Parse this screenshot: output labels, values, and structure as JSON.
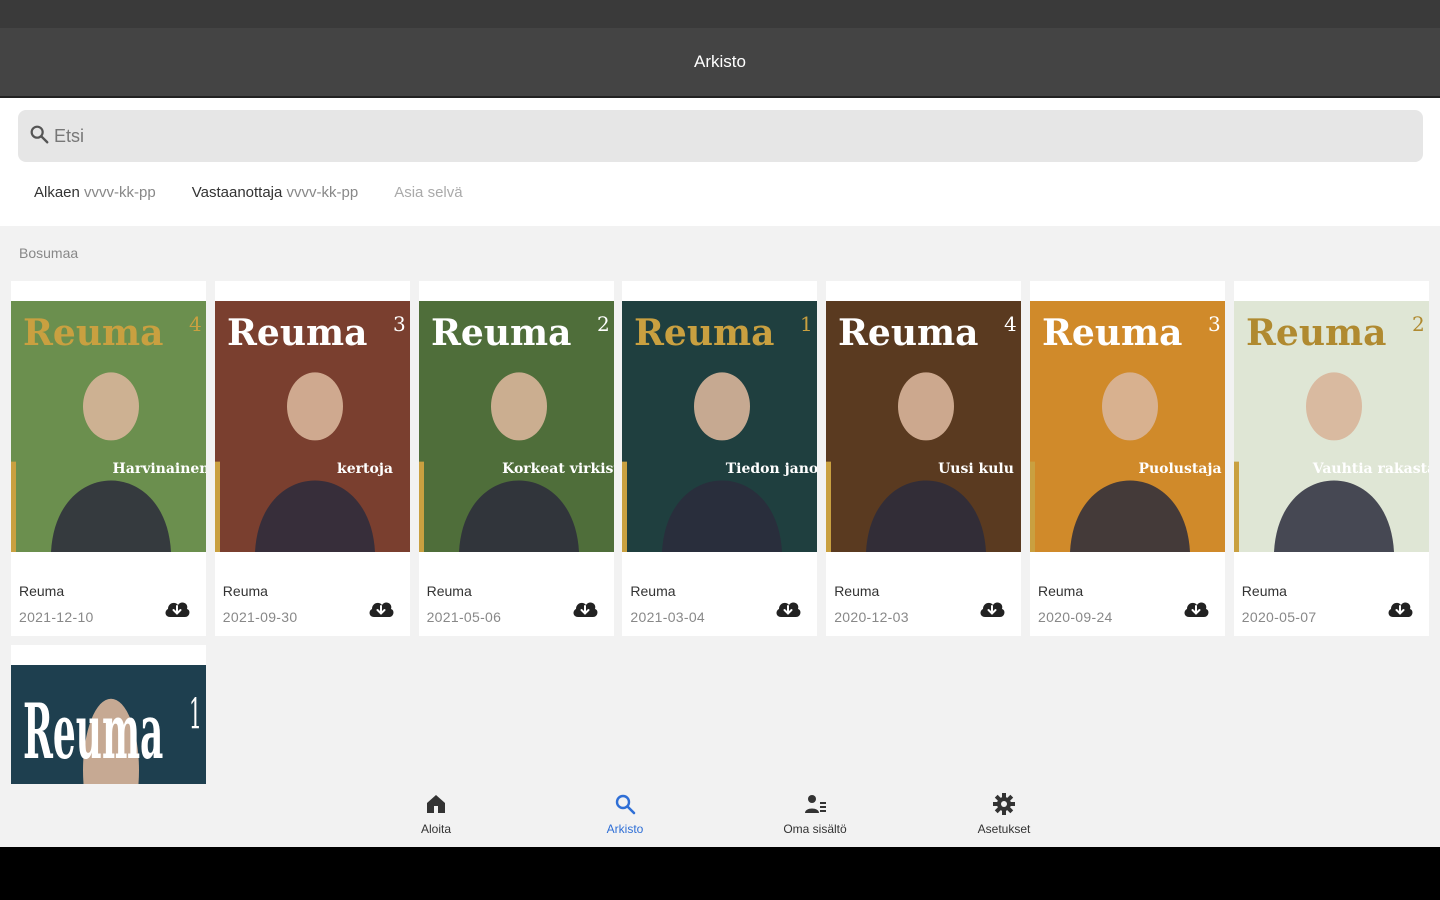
{
  "appbar": {
    "title": "Arkisto"
  },
  "search": {
    "placeholder": "Etsi",
    "icon": "search-icon"
  },
  "filters": {
    "from_label": "Alkaen",
    "from_placeholder": "vvvv-kk-pp",
    "to_label": "Vastaanottaja",
    "to_placeholder": "vvvv-kk-pp",
    "clear_label": "Asia selvä"
  },
  "section": {
    "label": "Bosumaa"
  },
  "colors": {
    "accent": "#2f6fd6",
    "appbar": "#444444",
    "cover_gold": "#c9a040"
  },
  "issues": [
    {
      "title": "Reuma",
      "date": "2021-12-10",
      "issue_number": "4",
      "headline": "Harvinainen",
      "title_color": "#c9a040",
      "bg": "#6b8f4e",
      "action_icon": "cloud-download-icon"
    },
    {
      "title": "Reuma",
      "date": "2021-09-30",
      "issue_number": "3",
      "headline": "kertoja",
      "title_color": "#ffffff",
      "bg": "#7a3f2f",
      "action_icon": "cloud-download-icon"
    },
    {
      "title": "Reuma",
      "date": "2021-05-06",
      "issue_number": "2",
      "headline": "Korkeat virkistys",
      "title_color": "#ffffff",
      "bg": "#4f6e3a",
      "action_icon": "cloud-download-icon"
    },
    {
      "title": "Reuma",
      "date": "2021-03-04",
      "issue_number": "1",
      "headline": "Tiedon jano",
      "title_color": "#c9a040",
      "bg": "#1f3f3f",
      "action_icon": "cloud-download-icon"
    },
    {
      "title": "Reuma",
      "date": "2020-12-03",
      "issue_number": "4",
      "headline": "Uusi kulu",
      "title_color": "#ffffff",
      "bg": "#5a3a20",
      "action_icon": "cloud-download-icon"
    },
    {
      "title": "Reuma",
      "date": "2020-09-24",
      "issue_number": "3",
      "headline": "Puolustaja",
      "title_color": "#ffffff",
      "bg": "#d08a2a",
      "action_icon": "cloud-download-icon"
    },
    {
      "title": "Reuma",
      "date": "2020-05-07",
      "issue_number": "2",
      "headline": "Vauhtia rakastaen",
      "title_color": "#b08a30",
      "bg": "#dfe6d5",
      "action_icon": "cloud-download-icon"
    }
  ],
  "partial_issue": {
    "issue_number": "1",
    "title_color": "#ffffff",
    "bg": "#1e3f4f"
  },
  "bottom_nav": [
    {
      "label": "Aloita",
      "icon": "home-icon",
      "active": false
    },
    {
      "label": "Arkisto",
      "icon": "search-icon",
      "active": true
    },
    {
      "label": "Oma sisältö",
      "icon": "person-list-icon",
      "active": false
    },
    {
      "label": "Asetukset",
      "icon": "gear-icon",
      "active": false
    }
  ]
}
